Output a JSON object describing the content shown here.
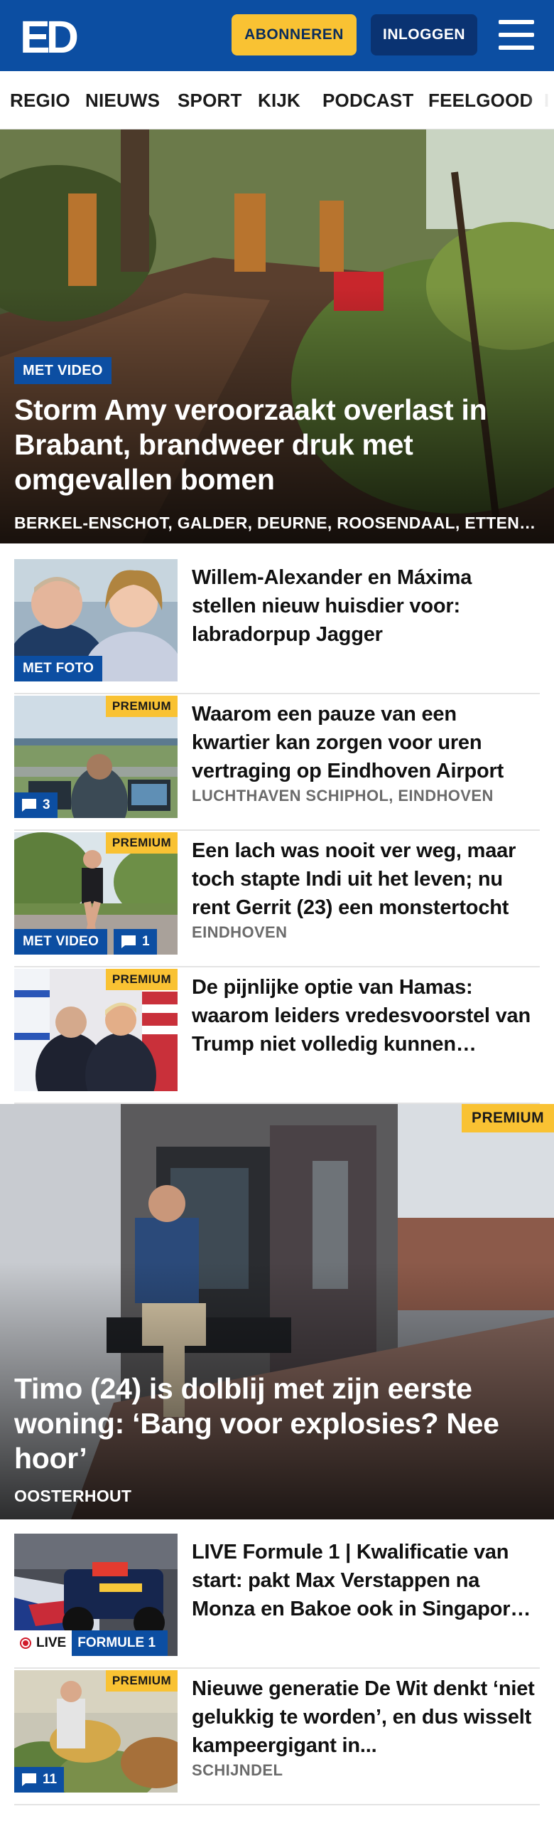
{
  "header": {
    "logo_text": "ED",
    "subscribe_label": "ABONNEREN",
    "login_label": "INLOGGEN",
    "menu_icon": "hamburger-menu-icon"
  },
  "nav": {
    "items": [
      "REGIO",
      "NIEUWS",
      "SPORT",
      "KIJK",
      "PODCAST",
      "FEELGOOD"
    ]
  },
  "hero1": {
    "badge": "MET VIDEO",
    "title": "Storm Amy veroorzaakt overlast in Brabant, brandweer druk met omgevallen bomen",
    "locations": "BERKEL-ENSCHOT, GALDER, DEURNE, ROOSENDAAL, ETTEN-LEUR"
  },
  "articles": [
    {
      "title": "Willem-Alexander en Máxima stellen nieuw huisdier voor: labradorpup Jagger",
      "badge": "MET FOTO"
    },
    {
      "title": "Waarom een pauze van een kwartier kan zorgen voor uren vertraging op Eindhoven Airport",
      "location": "LUCHTHAVEN SCHIPHOL, EINDHOVEN",
      "premium": "PREMIUM",
      "comments": "3"
    },
    {
      "title": "Een lach was nooit ver weg, maar toch stapte Indi uit het leven; nu rent Gerrit (23) een monstertocht",
      "location": "EINDHOVEN",
      "premium": "PREMIUM",
      "badge": "MET VIDEO",
      "comments": "1"
    },
    {
      "title": "De pijnlijke optie van Hamas: waarom leiders vredesvoorstel van Trump niet volledig kunnen afwijzen",
      "premium": "PREMIUM"
    }
  ],
  "hero2": {
    "premium": "PREMIUM",
    "title": "Timo (24) is dolblij met zijn eerste woning: ‘Bang voor explosies? Nee hoor’",
    "location": "OOSTERHOUT"
  },
  "articles2": [
    {
      "title": "LIVE Formule 1 | Kwalificatie van start: pakt Max Verstappen na Monza en Bakoe ook in Singapore pole?",
      "live": "LIVE",
      "tag": "FORMULE 1"
    },
    {
      "title": "Nieuwe generatie De Wit denkt ‘niet gelukkig te worden’, en dus wisselt kampeergigant in...",
      "location": "SCHIJNDEL",
      "premium": "PREMIUM",
      "comments": "11"
    }
  ],
  "colors": {
    "brand_blue": "#0c4ea2",
    "subscribe_yellow": "#f9c233",
    "login_blue": "#0a3372",
    "premium_yellow": "#f9c233",
    "live_red": "#d11a2a"
  }
}
